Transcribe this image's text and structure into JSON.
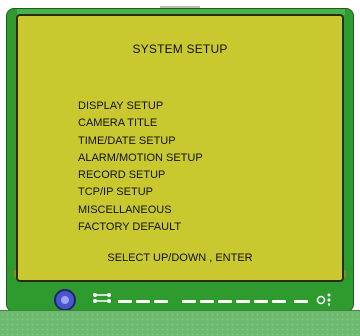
{
  "menu": {
    "title": "SYSTEM SETUP",
    "items": [
      "DISPLAY SETUP",
      "CAMERA TITLE",
      "TIME/DATE SETUP",
      "ALARM/MOTION SETUP",
      "RECORD SETUP",
      "TCP/IP SETUP",
      "MISCELLANEOUS",
      "FACTORY DEFAULT"
    ],
    "hint": "SELECT UP/DOWN , ENTER"
  },
  "colors": {
    "bezel": "#2f9b2f",
    "screen": "#c9c82f",
    "nav_button": "#4a56c8",
    "base": "#6db96d"
  },
  "icons": {
    "nav_button": "directional-pad-icon",
    "connector": "connector-icon",
    "power": "power-icon"
  }
}
